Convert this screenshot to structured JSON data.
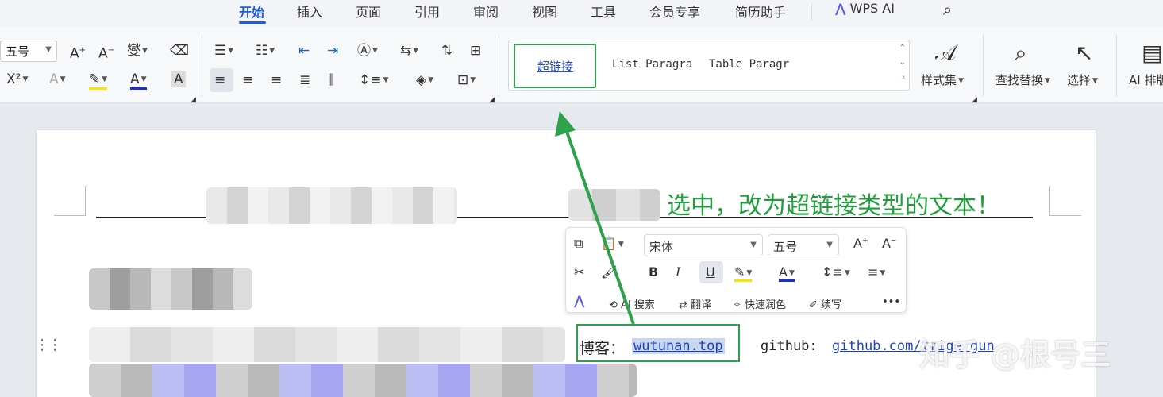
{
  "menu": {
    "tabs": [
      "开始",
      "插入",
      "页面",
      "引用",
      "审阅",
      "视图",
      "工具",
      "会员专享",
      "简历助手"
    ],
    "ai_label": "WPS AI"
  },
  "ribbon": {
    "font_size": "五号",
    "styles": {
      "selected": "超链接",
      "items": [
        "List Paragra",
        "Table Paragr"
      ]
    },
    "style_set_label": "样式集",
    "find_replace_label": "查找替换",
    "select_label": "选择",
    "ai_layout_label": "AI 排版"
  },
  "annotation": "选中，改为超链接类型的文本！",
  "float_toolbar": {
    "font_family": "宋体",
    "font_size": "五号",
    "ai_search": "AI 搜索",
    "translate": "翻译",
    "polish": "快速润色",
    "continue": "续写",
    "more": "•••"
  },
  "document": {
    "blog_label": "博客：",
    "blog_link": "wutunan.top",
    "github_label": "github:",
    "github_link": "github.com/trigergun"
  },
  "watermark": "知乎 @根号三",
  "colors": {
    "accent": "#1f5fd1",
    "highlight_box": "#2ea14b",
    "link": "#1b3fb8"
  }
}
